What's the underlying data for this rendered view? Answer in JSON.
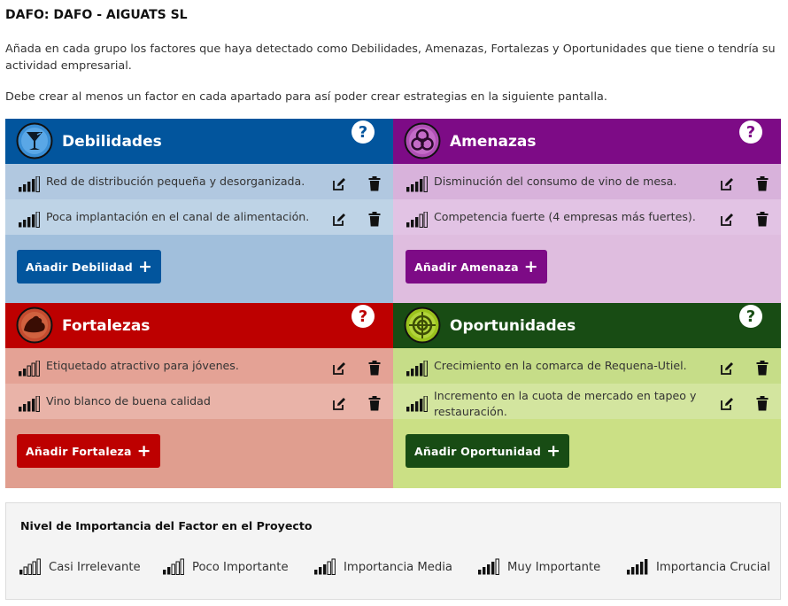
{
  "page": {
    "title": "DAFO: DAFO - AIGUATS SL",
    "intro1": "Añada en cada grupo los factores que haya detectado como Debilidades, Amenazas, Fortalezas y Oportunidades que tiene o tendría su actividad empresarial.",
    "intro2": "Debe crear al menos un factor en cada apartado para así poder crear estrategias en la siguiente pantalla."
  },
  "colors": {
    "debilidades": "#02559d",
    "debilidades_row_a": "#b1c8e0",
    "debilidades_row_b": "#bed3e6",
    "debilidades_body": "#a1bfdc",
    "amenazas": "#7d0b86",
    "amenazas_row_a": "#d8b2db",
    "amenazas_row_b": "#e2c3e4",
    "amenazas_body": "#dfbddf",
    "fortalezas": "#bd0000",
    "fortalezas_row_a": "#e4a295",
    "fortalezas_row_b": "#e9b3a8",
    "fortalezas_body": "#e09e8f",
    "oportunidades": "#184c14",
    "oportunidades_row_a": "#c6dd88",
    "oportunidades_row_b": "#d3e59f",
    "oportunidades_body": "#cbe085"
  },
  "quadrants": {
    "debilidades": {
      "title": "Debilidades",
      "icon": "glass-icon",
      "add_label": "Añadir Debilidad",
      "items": [
        {
          "text": "Red de distribución pequeña y desorganizada.",
          "level": 4
        },
        {
          "text": "Poca implantación en el canal de alimentación.",
          "level": 4
        }
      ]
    },
    "amenazas": {
      "title": "Amenazas",
      "icon": "biohazard-icon",
      "add_label": "Añadir Amenaza",
      "items": [
        {
          "text": "Disminución del consumo de vino de mesa.",
          "level": 4
        },
        {
          "text": "Competencia fuerte (4 empresas más fuertes).",
          "level": 3
        }
      ]
    },
    "fortalezas": {
      "title": "Fortalezas",
      "icon": "muscle-arm-icon",
      "add_label": "Añadir Fortaleza",
      "items": [
        {
          "text": "Etiquetado atractivo para jóvenes.",
          "level": 2
        },
        {
          "text": "Vino blanco de buena calidad",
          "level": 4
        }
      ]
    },
    "oportunidades": {
      "title": "Oportunidades",
      "icon": "target-icon",
      "add_label": "Añadir Oportunidad",
      "items": [
        {
          "text": "Crecimiento en la comarca de Requena-Utiel.",
          "level": 4
        },
        {
          "text": "Incremento en la cuota de mercado en tapeo y restauración.",
          "level": 4
        }
      ]
    }
  },
  "legend": {
    "title": "Nivel de Importancia del Factor en el Proyecto",
    "items": [
      {
        "label": "Casi Irrelevante",
        "level": 1
      },
      {
        "label": "Poco Importante",
        "level": 2
      },
      {
        "label": "Importancia Media",
        "level": 3
      },
      {
        "label": "Muy Importante",
        "level": 4
      },
      {
        "label": "Importancia Crucial",
        "level": 5
      }
    ]
  }
}
